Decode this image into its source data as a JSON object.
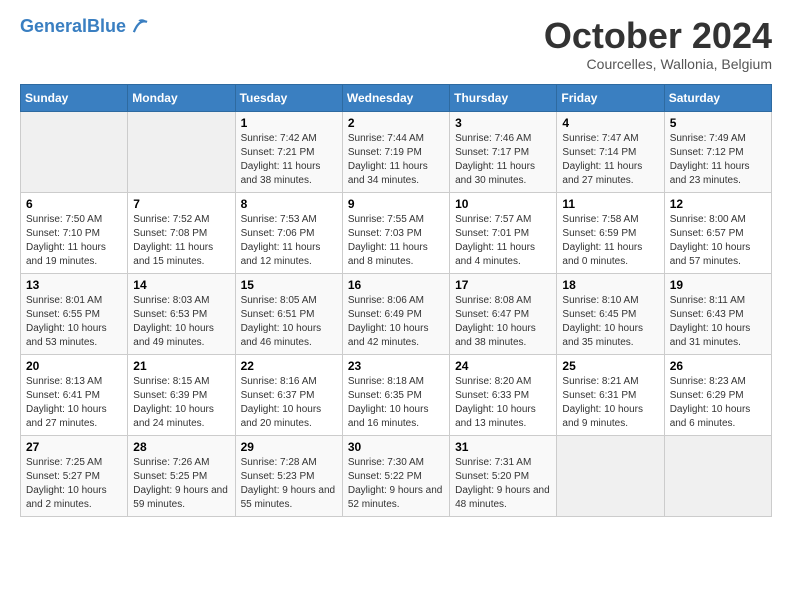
{
  "header": {
    "logo_general": "General",
    "logo_blue": "Blue",
    "month": "October 2024",
    "location": "Courcelles, Wallonia, Belgium"
  },
  "days_of_week": [
    "Sunday",
    "Monday",
    "Tuesday",
    "Wednesday",
    "Thursday",
    "Friday",
    "Saturday"
  ],
  "weeks": [
    [
      {
        "day": "",
        "sunrise": "",
        "sunset": "",
        "daylight": ""
      },
      {
        "day": "",
        "sunrise": "",
        "sunset": "",
        "daylight": ""
      },
      {
        "day": "1",
        "sunrise": "Sunrise: 7:42 AM",
        "sunset": "Sunset: 7:21 PM",
        "daylight": "Daylight: 11 hours and 38 minutes."
      },
      {
        "day": "2",
        "sunrise": "Sunrise: 7:44 AM",
        "sunset": "Sunset: 7:19 PM",
        "daylight": "Daylight: 11 hours and 34 minutes."
      },
      {
        "day": "3",
        "sunrise": "Sunrise: 7:46 AM",
        "sunset": "Sunset: 7:17 PM",
        "daylight": "Daylight: 11 hours and 30 minutes."
      },
      {
        "day": "4",
        "sunrise": "Sunrise: 7:47 AM",
        "sunset": "Sunset: 7:14 PM",
        "daylight": "Daylight: 11 hours and 27 minutes."
      },
      {
        "day": "5",
        "sunrise": "Sunrise: 7:49 AM",
        "sunset": "Sunset: 7:12 PM",
        "daylight": "Daylight: 11 hours and 23 minutes."
      }
    ],
    [
      {
        "day": "6",
        "sunrise": "Sunrise: 7:50 AM",
        "sunset": "Sunset: 7:10 PM",
        "daylight": "Daylight: 11 hours and 19 minutes."
      },
      {
        "day": "7",
        "sunrise": "Sunrise: 7:52 AM",
        "sunset": "Sunset: 7:08 PM",
        "daylight": "Daylight: 11 hours and 15 minutes."
      },
      {
        "day": "8",
        "sunrise": "Sunrise: 7:53 AM",
        "sunset": "Sunset: 7:06 PM",
        "daylight": "Daylight: 11 hours and 12 minutes."
      },
      {
        "day": "9",
        "sunrise": "Sunrise: 7:55 AM",
        "sunset": "Sunset: 7:03 PM",
        "daylight": "Daylight: 11 hours and 8 minutes."
      },
      {
        "day": "10",
        "sunrise": "Sunrise: 7:57 AM",
        "sunset": "Sunset: 7:01 PM",
        "daylight": "Daylight: 11 hours and 4 minutes."
      },
      {
        "day": "11",
        "sunrise": "Sunrise: 7:58 AM",
        "sunset": "Sunset: 6:59 PM",
        "daylight": "Daylight: 11 hours and 0 minutes."
      },
      {
        "day": "12",
        "sunrise": "Sunrise: 8:00 AM",
        "sunset": "Sunset: 6:57 PM",
        "daylight": "Daylight: 10 hours and 57 minutes."
      }
    ],
    [
      {
        "day": "13",
        "sunrise": "Sunrise: 8:01 AM",
        "sunset": "Sunset: 6:55 PM",
        "daylight": "Daylight: 10 hours and 53 minutes."
      },
      {
        "day": "14",
        "sunrise": "Sunrise: 8:03 AM",
        "sunset": "Sunset: 6:53 PM",
        "daylight": "Daylight: 10 hours and 49 minutes."
      },
      {
        "day": "15",
        "sunrise": "Sunrise: 8:05 AM",
        "sunset": "Sunset: 6:51 PM",
        "daylight": "Daylight: 10 hours and 46 minutes."
      },
      {
        "day": "16",
        "sunrise": "Sunrise: 8:06 AM",
        "sunset": "Sunset: 6:49 PM",
        "daylight": "Daylight: 10 hours and 42 minutes."
      },
      {
        "day": "17",
        "sunrise": "Sunrise: 8:08 AM",
        "sunset": "Sunset: 6:47 PM",
        "daylight": "Daylight: 10 hours and 38 minutes."
      },
      {
        "day": "18",
        "sunrise": "Sunrise: 8:10 AM",
        "sunset": "Sunset: 6:45 PM",
        "daylight": "Daylight: 10 hours and 35 minutes."
      },
      {
        "day": "19",
        "sunrise": "Sunrise: 8:11 AM",
        "sunset": "Sunset: 6:43 PM",
        "daylight": "Daylight: 10 hours and 31 minutes."
      }
    ],
    [
      {
        "day": "20",
        "sunrise": "Sunrise: 8:13 AM",
        "sunset": "Sunset: 6:41 PM",
        "daylight": "Daylight: 10 hours and 27 minutes."
      },
      {
        "day": "21",
        "sunrise": "Sunrise: 8:15 AM",
        "sunset": "Sunset: 6:39 PM",
        "daylight": "Daylight: 10 hours and 24 minutes."
      },
      {
        "day": "22",
        "sunrise": "Sunrise: 8:16 AM",
        "sunset": "Sunset: 6:37 PM",
        "daylight": "Daylight: 10 hours and 20 minutes."
      },
      {
        "day": "23",
        "sunrise": "Sunrise: 8:18 AM",
        "sunset": "Sunset: 6:35 PM",
        "daylight": "Daylight: 10 hours and 16 minutes."
      },
      {
        "day": "24",
        "sunrise": "Sunrise: 8:20 AM",
        "sunset": "Sunset: 6:33 PM",
        "daylight": "Daylight: 10 hours and 13 minutes."
      },
      {
        "day": "25",
        "sunrise": "Sunrise: 8:21 AM",
        "sunset": "Sunset: 6:31 PM",
        "daylight": "Daylight: 10 hours and 9 minutes."
      },
      {
        "day": "26",
        "sunrise": "Sunrise: 8:23 AM",
        "sunset": "Sunset: 6:29 PM",
        "daylight": "Daylight: 10 hours and 6 minutes."
      }
    ],
    [
      {
        "day": "27",
        "sunrise": "Sunrise: 7:25 AM",
        "sunset": "Sunset: 5:27 PM",
        "daylight": "Daylight: 10 hours and 2 minutes."
      },
      {
        "day": "28",
        "sunrise": "Sunrise: 7:26 AM",
        "sunset": "Sunset: 5:25 PM",
        "daylight": "Daylight: 9 hours and 59 minutes."
      },
      {
        "day": "29",
        "sunrise": "Sunrise: 7:28 AM",
        "sunset": "Sunset: 5:23 PM",
        "daylight": "Daylight: 9 hours and 55 minutes."
      },
      {
        "day": "30",
        "sunrise": "Sunrise: 7:30 AM",
        "sunset": "Sunset: 5:22 PM",
        "daylight": "Daylight: 9 hours and 52 minutes."
      },
      {
        "day": "31",
        "sunrise": "Sunrise: 7:31 AM",
        "sunset": "Sunset: 5:20 PM",
        "daylight": "Daylight: 9 hours and 48 minutes."
      },
      {
        "day": "",
        "sunrise": "",
        "sunset": "",
        "daylight": ""
      },
      {
        "day": "",
        "sunrise": "",
        "sunset": "",
        "daylight": ""
      }
    ]
  ]
}
